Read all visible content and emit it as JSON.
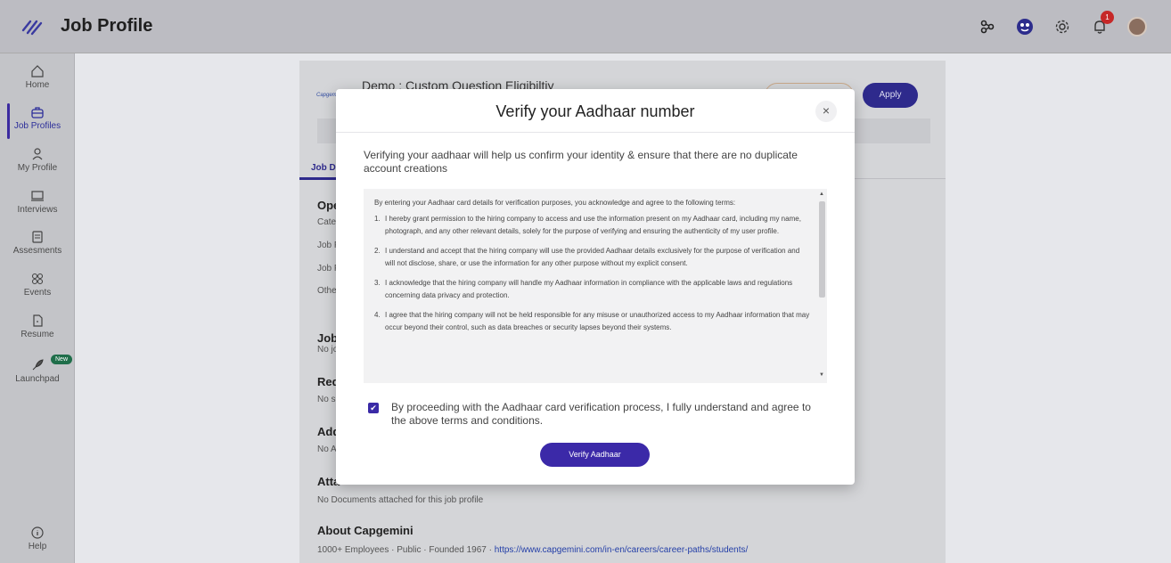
{
  "header": {
    "title": "Job Profile",
    "notification_count": "1",
    "icons": [
      "integrations-icon",
      "help-circle-icon",
      "settings-gear-icon",
      "bell-icon",
      "avatar"
    ]
  },
  "sidebar": {
    "items": [
      {
        "label": "Home",
        "icon": "home-icon"
      },
      {
        "label": "Job Profiles",
        "icon": "briefcase-icon",
        "active": true
      },
      {
        "label": "My Profile",
        "icon": "user-icon"
      },
      {
        "label": "Interviews",
        "icon": "monitor-icon"
      },
      {
        "label": "Assesments",
        "icon": "document-icon"
      },
      {
        "label": "Events",
        "icon": "grid-icon"
      },
      {
        "label": "Resume",
        "icon": "file-icon"
      },
      {
        "label": "Launchpad",
        "icon": "rocket-icon",
        "badge": "New"
      }
    ],
    "help_label": "Help"
  },
  "background": {
    "company_logo": "Capgemini",
    "job_title": "Demo : Custom Question Eligibiltiy",
    "apply_label": "Apply",
    "tab_label": "Job D",
    "section_partial": "Ope",
    "row1": "Cate",
    "row2": "Job F",
    "row3": "Job F",
    "row4": "Othe",
    "job_section": "Job",
    "job_section_sub": "No jo",
    "req_section": "Req",
    "req_sub": "No sl",
    "add_section": "Add",
    "add_sub": "No A",
    "attached_heading": "Atta",
    "attached_text": "No Documents attached for this job profile",
    "about_heading": "About Capgemini",
    "about_meta": "1000+ Employees · Public · Founded 1967 ·",
    "about_link": "https://www.capgemini.com/in-en/careers/career-paths/students/"
  },
  "modal": {
    "title": "Verify your Aadhaar number",
    "close_label": "×",
    "description": "Verifying your aadhaar will help us confirm your identity & ensure that there are no duplicate account creations",
    "terms_intro": "By entering your Aadhaar card details for verification purposes, you acknowledge and agree to the following terms:",
    "terms": [
      {
        "num": "1.",
        "text": "I hereby grant permission to the hiring company to access and use the information present on my Aadhaar card, including my name, photograph, and any other relevant details, solely for the purpose of verifying and ensuring the authenticity of my user profile."
      },
      {
        "num": "2.",
        "text": "I understand and accept that the hiring company will use the provided Aadhaar details exclusively for the purpose of verification and will not disclose, share, or use the information for any other purpose without my explicit consent."
      },
      {
        "num": "3.",
        "text": "I acknowledge that the hiring company will handle my Aadhaar information in compliance with the applicable laws and regulations concerning data privacy and protection."
      },
      {
        "num": "4.",
        "text": "I agree that the hiring company will not be held responsible for any misuse or unauthorized access to my Aadhaar information that may occur beyond their control, such as data breaches or security lapses beyond their systems."
      }
    ],
    "consent_checked": true,
    "consent_text": "By proceeding with the Aadhaar card verification process, I fully understand and agree to the above terms and conditions.",
    "verify_button": "Verify Aadhaar"
  },
  "colors": {
    "accent": "#3b29a8",
    "overlay_bg": "#bcbcc2",
    "badge_new": "#1f6e4a",
    "notif_badge": "#c62828"
  }
}
